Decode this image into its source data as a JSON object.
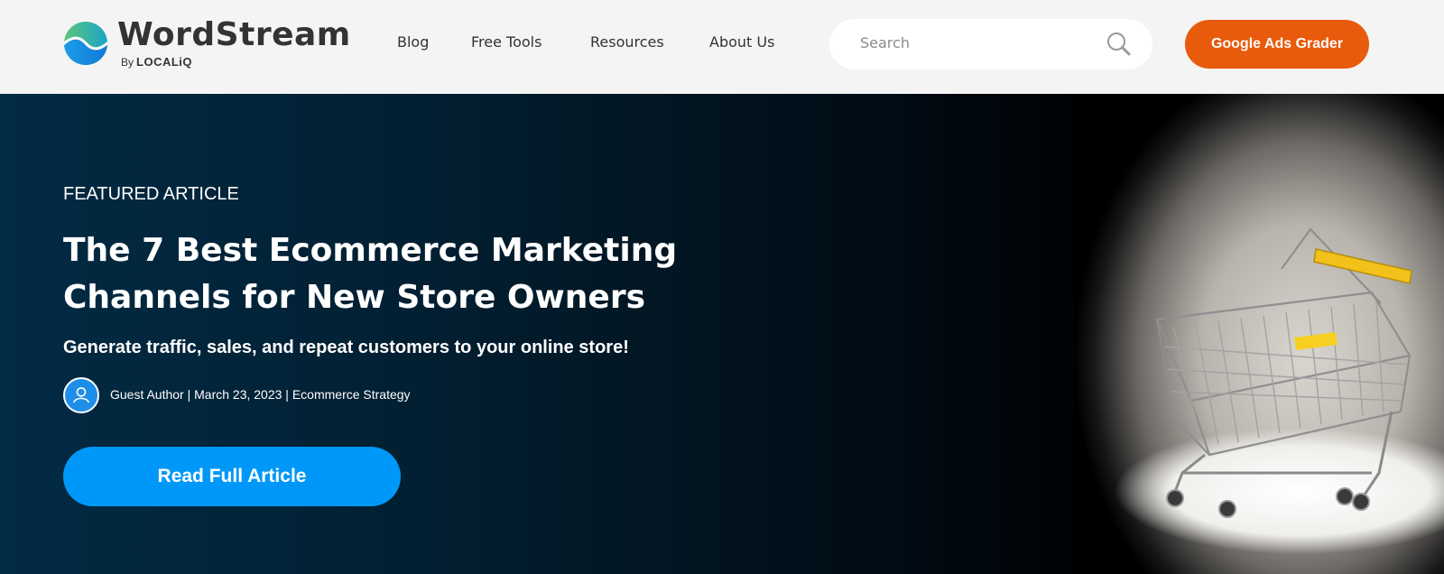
{
  "brand": {
    "name": "WordStream",
    "by": "By",
    "parent": "LOCALiQ"
  },
  "nav": {
    "items": [
      {
        "label": "Blog"
      },
      {
        "label": "Free Tools"
      },
      {
        "label": "Resources"
      },
      {
        "label": "About Us"
      }
    ]
  },
  "search": {
    "placeholder": "Search",
    "icon": "magnifier-icon"
  },
  "cta_header": {
    "label": "Google Ads Grader",
    "color": "#e85a0c"
  },
  "hero": {
    "kicker": "FEATURED ARTICLE",
    "title": "The 7 Best Ecommerce Marketing Channels for New Store Owners",
    "subtitle": "Generate traffic, sales, and repeat customers to your online store!",
    "meta": "Guest Author | March 23, 2023 | Ecommerce Strategy",
    "avatar_icon": "user-avatar-icon",
    "image": "shopping-cart-spotlight",
    "button": "Read Full Article",
    "button_color": "#0098f8"
  }
}
